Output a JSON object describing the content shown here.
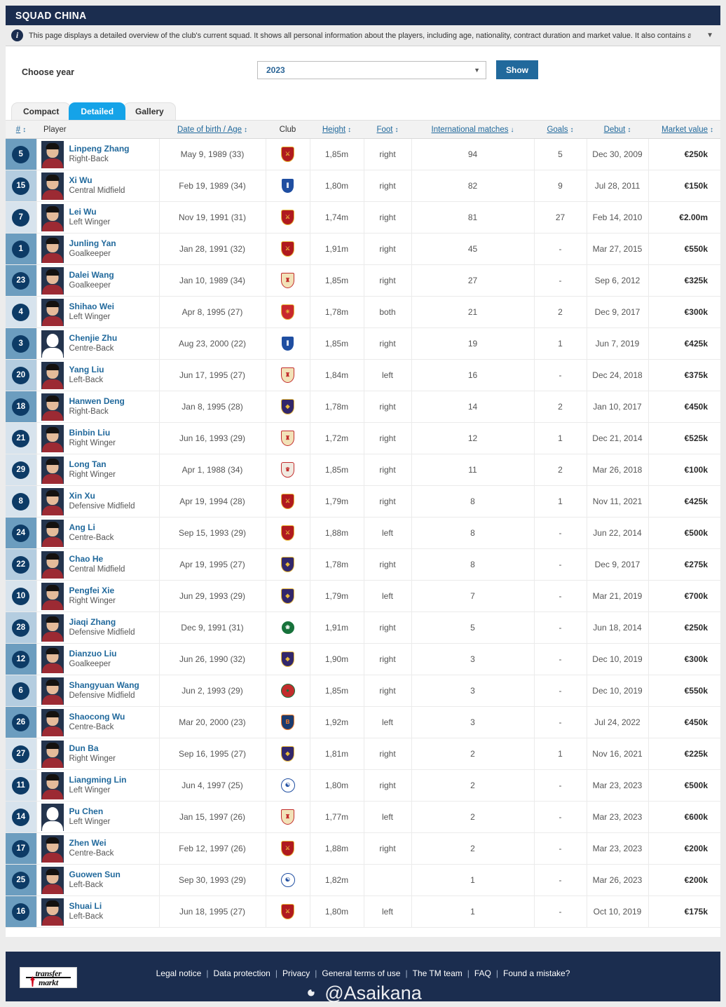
{
  "header": {
    "title": "SQUAD CHINA"
  },
  "notice": {
    "icon": "info-icon",
    "text": "This page displays a detailed overview of the club's current squad. It shows all personal information about the players, including age, nationality, contract duration and market value. It also contains a table with average age...",
    "expand_icon": "chevron-down-icon"
  },
  "filter": {
    "label": "Choose year",
    "selected_year": "2023",
    "caret_icon": "chevron-down-icon",
    "show_button": "Show"
  },
  "tabs": [
    {
      "label": "Compact",
      "active": false
    },
    {
      "label": "Detailed",
      "active": true
    },
    {
      "label": "Gallery",
      "active": false
    }
  ],
  "table": {
    "columns": [
      {
        "label": "#",
        "sortable": true,
        "sort": "both"
      },
      {
        "label": "Player",
        "sortable": false,
        "sort": "none"
      },
      {
        "label": "Date of birth / Age",
        "sortable": true,
        "sort": "both"
      },
      {
        "label": "Club",
        "sortable": false,
        "sort": "none"
      },
      {
        "label": "Height",
        "sortable": true,
        "sort": "both"
      },
      {
        "label": "Foot",
        "sortable": true,
        "sort": "both"
      },
      {
        "label": "International matches",
        "sortable": true,
        "sort": "desc"
      },
      {
        "label": "Goals",
        "sortable": true,
        "sort": "both"
      },
      {
        "label": "Debut",
        "sortable": true,
        "sort": "both"
      },
      {
        "label": "Market value",
        "sortable": true,
        "sort": "both"
      }
    ],
    "rows": [
      {
        "number": "5",
        "shade": 2,
        "name": "Linpeng Zhang",
        "position": "Right-Back",
        "dob": "May 9, 1989 (33)",
        "club": "shanghai-port",
        "crest": {
          "shape": "shield",
          "bg": "#b01a1f",
          "accent": "#e8b93a",
          "mark": "⚔"
        },
        "height": "1,85m",
        "foot": "right",
        "intl": "94",
        "goals": "5",
        "debut": "Dec 30, 2009",
        "market_value": "€250k"
      },
      {
        "number": "15",
        "shade": 1,
        "name": "Xi Wu",
        "position": "Central Midfield",
        "dob": "Feb 19, 1989 (34)",
        "club": "shanghai-shenhua",
        "crest": {
          "shape": "shield",
          "bg": "#1f4ea1",
          "accent": "#ffffff",
          "mark": "⫼"
        },
        "height": "1,80m",
        "foot": "right",
        "intl": "82",
        "goals": "9",
        "debut": "Jul 28, 2011",
        "market_value": "€150k"
      },
      {
        "number": "7",
        "shade": 0,
        "name": "Lei Wu",
        "position": "Left Winger",
        "dob": "Nov 19, 1991 (31)",
        "club": "shanghai-port",
        "crest": {
          "shape": "shield",
          "bg": "#b01a1f",
          "accent": "#e8b93a",
          "mark": "⚔"
        },
        "height": "1,74m",
        "foot": "right",
        "intl": "81",
        "goals": "27",
        "debut": "Feb 14, 2010",
        "market_value": "€2.00m"
      },
      {
        "number": "1",
        "shade": 2,
        "name": "Junling Yan",
        "position": "Goalkeeper",
        "dob": "Jan 28, 1991 (32)",
        "club": "shanghai-port",
        "crest": {
          "shape": "shield",
          "bg": "#b01a1f",
          "accent": "#e8b93a",
          "mark": "⚔"
        },
        "height": "1,91m",
        "foot": "right",
        "intl": "45",
        "goals": "-",
        "debut": "Mar 27, 2015",
        "market_value": "€550k"
      },
      {
        "number": "23",
        "shade": 2,
        "name": "Dalei Wang",
        "position": "Goalkeeper",
        "dob": "Jan 10, 1989 (34)",
        "club": "shandong-taishan",
        "crest": {
          "shape": "banner",
          "bg": "#f2e2b8",
          "accent": "#c22c2c",
          "mark": "♜"
        },
        "height": "1,85m",
        "foot": "right",
        "intl": "27",
        "goals": "-",
        "debut": "Sep 6, 2012",
        "market_value": "€325k"
      },
      {
        "number": "4",
        "shade": 0,
        "name": "Shihao Wei",
        "position": "Left Winger",
        "dob": "Apr 8, 1995 (27)",
        "club": "guangzhou-fc",
        "crest": {
          "shape": "shield",
          "bg": "#c8282d",
          "accent": "#e8b93a",
          "mark": "☀"
        },
        "height": "1,78m",
        "foot": "both",
        "intl": "21",
        "goals": "2",
        "debut": "Dec 9, 2017",
        "market_value": "€300k"
      },
      {
        "number": "3",
        "shade": 2,
        "name": "Chenjie Zhu",
        "position": "Centre-Back",
        "dob": "Aug 23, 2000 (22)",
        "club": "shanghai-shenhua",
        "crest": {
          "shape": "shield",
          "bg": "#1f4ea1",
          "accent": "#ffffff",
          "mark": "⫼"
        },
        "height": "1,85m",
        "foot": "right",
        "intl": "19",
        "goals": "1",
        "debut": "Jun 7, 2019",
        "market_value": "€425k",
        "silhouette": true
      },
      {
        "number": "20",
        "shade": 1,
        "name": "Yang Liu",
        "position": "Left-Back",
        "dob": "Jun 17, 1995 (27)",
        "club": "shandong-taishan",
        "crest": {
          "shape": "banner",
          "bg": "#f2e2b8",
          "accent": "#c22c2c",
          "mark": "♜"
        },
        "height": "1,84m",
        "foot": "left",
        "intl": "16",
        "goals": "-",
        "debut": "Dec 24, 2018",
        "market_value": "€375k"
      },
      {
        "number": "18",
        "shade": 2,
        "name": "Hanwen Deng",
        "position": "Right-Back",
        "dob": "Jan 8, 1995 (28)",
        "club": "wuhan-three-towns",
        "crest": {
          "shape": "shield",
          "bg": "#32276b",
          "accent": "#e8b93a",
          "mark": "◆"
        },
        "height": "1,78m",
        "foot": "right",
        "intl": "14",
        "goals": "2",
        "debut": "Jan 10, 2017",
        "market_value": "€450k"
      },
      {
        "number": "21",
        "shade": 0,
        "name": "Binbin Liu",
        "position": "Right Winger",
        "dob": "Jun 16, 1993 (29)",
        "club": "shandong-taishan",
        "crest": {
          "shape": "banner",
          "bg": "#f2e2b8",
          "accent": "#c22c2c",
          "mark": "♜"
        },
        "height": "1,72m",
        "foot": "right",
        "intl": "12",
        "goals": "1",
        "debut": "Dec 21, 2014",
        "market_value": "€525k"
      },
      {
        "number": "29",
        "shade": 0,
        "name": "Long Tan",
        "position": "Right Winger",
        "dob": "Apr 1, 1988 (34)",
        "club": "chengdu-rongcheng",
        "crest": {
          "shape": "shield",
          "bg": "#f0e9e0",
          "accent": "#c22c2c",
          "mark": "♛"
        },
        "height": "1,85m",
        "foot": "right",
        "intl": "11",
        "goals": "2",
        "debut": "Mar 26, 2018",
        "market_value": "€100k"
      },
      {
        "number": "8",
        "shade": 0,
        "name": "Xin Xu",
        "position": "Defensive Midfield",
        "dob": "Apr 19, 1994 (28)",
        "club": "shanghai-port",
        "crest": {
          "shape": "shield",
          "bg": "#b01a1f",
          "accent": "#e8b93a",
          "mark": "⚔"
        },
        "height": "1,79m",
        "foot": "right",
        "intl": "8",
        "goals": "1",
        "debut": "Nov 11, 2021",
        "market_value": "€425k"
      },
      {
        "number": "24",
        "shade": 2,
        "name": "Ang Li",
        "position": "Centre-Back",
        "dob": "Sep 15, 1993 (29)",
        "club": "shanghai-port",
        "crest": {
          "shape": "shield",
          "bg": "#b01a1f",
          "accent": "#e8b93a",
          "mark": "⚔"
        },
        "height": "1,88m",
        "foot": "left",
        "intl": "8",
        "goals": "-",
        "debut": "Jun 22, 2014",
        "market_value": "€500k"
      },
      {
        "number": "22",
        "shade": 1,
        "name": "Chao He",
        "position": "Central Midfield",
        "dob": "Apr 19, 1995 (27)",
        "club": "wuhan-three-towns",
        "crest": {
          "shape": "shield",
          "bg": "#32276b",
          "accent": "#e8b93a",
          "mark": "◆"
        },
        "height": "1,78m",
        "foot": "right",
        "intl": "8",
        "goals": "-",
        "debut": "Dec 9, 2017",
        "market_value": "€275k"
      },
      {
        "number": "10",
        "shade": 0,
        "name": "Pengfei Xie",
        "position": "Right Winger",
        "dob": "Jun 29, 1993 (29)",
        "club": "wuhan-three-towns",
        "crest": {
          "shape": "shield",
          "bg": "#32276b",
          "accent": "#e8b93a",
          "mark": "◆"
        },
        "height": "1,79m",
        "foot": "left",
        "intl": "7",
        "goals": "-",
        "debut": "Mar 21, 2019",
        "market_value": "€700k"
      },
      {
        "number": "28",
        "shade": 1,
        "name": "Jiaqi Zhang",
        "position": "Defensive Midfield",
        "dob": "Dec 9, 1991 (31)",
        "club": "beijing-guoan",
        "crest": {
          "shape": "round",
          "bg": "#17723b",
          "accent": "#ffffff",
          "mark": "❀"
        },
        "height": "1,91m",
        "foot": "right",
        "intl": "5",
        "goals": "-",
        "debut": "Jun 18, 2014",
        "market_value": "€250k"
      },
      {
        "number": "12",
        "shade": 2,
        "name": "Dianzuo Liu",
        "position": "Goalkeeper",
        "dob": "Jun 26, 1990 (32)",
        "club": "wuhan-three-towns",
        "crest": {
          "shape": "shield",
          "bg": "#32276b",
          "accent": "#e8b93a",
          "mark": "◆"
        },
        "height": "1,90m",
        "foot": "right",
        "intl": "3",
        "goals": "-",
        "debut": "Dec 10, 2019",
        "market_value": "€300k"
      },
      {
        "number": "6",
        "shade": 1,
        "name": "Shangyuan Wang",
        "position": "Defensive Midfield",
        "dob": "Jun 2, 1993 (29)",
        "club": "henan-songshan",
        "crest": {
          "shape": "round",
          "bg": "#c22c2c",
          "accent": "#17723b",
          "mark": "●"
        },
        "height": "1,85m",
        "foot": "right",
        "intl": "3",
        "goals": "-",
        "debut": "Dec 10, 2019",
        "market_value": "€550k"
      },
      {
        "number": "26",
        "shade": 2,
        "name": "Shaocong Wu",
        "position": "Centre-Back",
        "dob": "Mar 20, 2000 (23)",
        "club": "istanbul-basaksehir",
        "crest": {
          "shape": "shield",
          "bg": "#1b3b6f",
          "accent": "#ff7f27",
          "mark": "B"
        },
        "height": "1,92m",
        "foot": "left",
        "intl": "3",
        "goals": "-",
        "debut": "Jul 24, 2022",
        "market_value": "€450k"
      },
      {
        "number": "27",
        "shade": 0,
        "name": "Dun Ba",
        "position": "Right Winger",
        "dob": "Sep 16, 1995 (27)",
        "club": "wuhan-three-towns",
        "crest": {
          "shape": "shield",
          "bg": "#32276b",
          "accent": "#e8b93a",
          "mark": "◆"
        },
        "height": "1,81m",
        "foot": "right",
        "intl": "2",
        "goals": "1",
        "debut": "Nov 16, 2021",
        "market_value": "€225k"
      },
      {
        "number": "11",
        "shade": 0,
        "name": "Liangming Lin",
        "position": "Left Winger",
        "dob": "Jun 4, 1997 (25)",
        "club": "dalian-pro",
        "crest": {
          "shape": "round",
          "bg": "#ffffff",
          "accent": "#1f4ea1",
          "mark": "☯"
        },
        "height": "1,80m",
        "foot": "right",
        "intl": "2",
        "goals": "-",
        "debut": "Mar 23, 2023",
        "market_value": "€500k"
      },
      {
        "number": "14",
        "shade": 0,
        "name": "Pu Chen",
        "position": "Left Winger",
        "dob": "Jan 15, 1997 (26)",
        "club": "shandong-taishan",
        "crest": {
          "shape": "banner",
          "bg": "#f2e2b8",
          "accent": "#c22c2c",
          "mark": "♜"
        },
        "height": "1,77m",
        "foot": "left",
        "intl": "2",
        "goals": "-",
        "debut": "Mar 23, 2023",
        "market_value": "€600k",
        "silhouette": true
      },
      {
        "number": "17",
        "shade": 2,
        "name": "Zhen Wei",
        "position": "Centre-Back",
        "dob": "Feb 12, 1997 (26)",
        "club": "shanghai-port",
        "crest": {
          "shape": "shield",
          "bg": "#b01a1f",
          "accent": "#e8b93a",
          "mark": "⚔"
        },
        "height": "1,88m",
        "foot": "right",
        "intl": "2",
        "goals": "-",
        "debut": "Mar 23, 2023",
        "market_value": "€200k"
      },
      {
        "number": "25",
        "shade": 2,
        "name": "Guowen Sun",
        "position": "Left-Back",
        "dob": "Sep 30, 1993 (29)",
        "club": "dalian-pro",
        "crest": {
          "shape": "round",
          "bg": "#ffffff",
          "accent": "#1f4ea1",
          "mark": "☯"
        },
        "height": "1,82m",
        "foot": "",
        "intl": "1",
        "goals": "-",
        "debut": "Mar 26, 2023",
        "market_value": "€200k"
      },
      {
        "number": "16",
        "shade": 2,
        "name": "Shuai Li",
        "position": "Left-Back",
        "dob": "Jun 18, 1995 (27)",
        "club": "shanghai-port",
        "crest": {
          "shape": "shield",
          "bg": "#b01a1f",
          "accent": "#e8b93a",
          "mark": "⚔"
        },
        "height": "1,80m",
        "foot": "left",
        "intl": "1",
        "goals": "-",
        "debut": "Oct 10, 2019",
        "market_value": "€175k"
      }
    ]
  },
  "footer": {
    "logo_line1": "transfer",
    "logo_line2": "markt",
    "links": [
      "Legal notice",
      "Data protection",
      "Privacy",
      "General terms of use",
      "The TM team",
      "FAQ",
      "Found a mistake?"
    ],
    "watermark": "@Asaikana"
  },
  "colors": {
    "brand_navy": "#1b2d4f",
    "accent_blue": "#21699c",
    "tab_active": "#15a3e8",
    "link": "#21699c"
  }
}
